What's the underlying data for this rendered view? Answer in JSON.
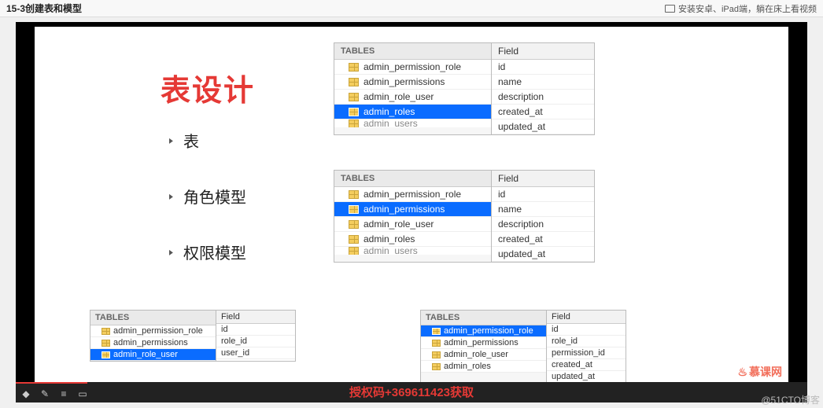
{
  "header": {
    "title": "15-3创建表和模型",
    "right_text": "安装安卓、iPad端，躺在床上看视频"
  },
  "slide": {
    "title": "表设计",
    "bullets": [
      "表",
      "角色模型",
      "权限模型"
    ]
  },
  "panel1": {
    "tables_header": "TABLES",
    "tables": [
      "admin_permission_role",
      "admin_permissions",
      "admin_role_user",
      "admin_roles",
      "admin_users"
    ],
    "selected_index": 3,
    "fields_header": "Field",
    "fields": [
      "id",
      "name",
      "description",
      "created_at",
      "updated_at"
    ]
  },
  "panel2": {
    "tables_header": "TABLES",
    "tables": [
      "admin_permission_role",
      "admin_permissions",
      "admin_role_user",
      "admin_roles",
      "admin_users"
    ],
    "selected_index": 1,
    "fields_header": "Field",
    "fields": [
      "id",
      "name",
      "description",
      "created_at",
      "updated_at"
    ]
  },
  "panel3": {
    "tables_header": "TABLES",
    "tables": [
      "admin_permission_role",
      "admin_permissions",
      "admin_role_user"
    ],
    "selected_index": 2,
    "fields_header": "Field",
    "fields": [
      "id",
      "role_id",
      "user_id"
    ]
  },
  "panel4": {
    "tables_header": "TABLES",
    "tables": [
      "admin_permission_role",
      "admin_permissions",
      "admin_role_user",
      "admin_roles"
    ],
    "selected_index": 0,
    "fields_header": "Field",
    "fields": [
      "id",
      "role_id",
      "permission_id",
      "created_at",
      "updated_at"
    ]
  },
  "footer": {
    "auth_text": "授权码+369611423获取",
    "brand": "慕课网",
    "watermark": "@51CTO博客"
  }
}
